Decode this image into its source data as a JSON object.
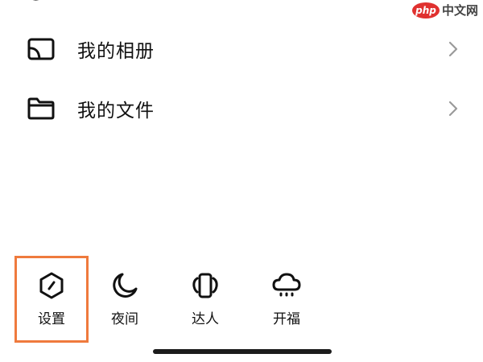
{
  "watermark": {
    "logo": "php",
    "text": "中文网"
  },
  "menu": {
    "items": [
      {
        "label": "我的相册",
        "icon": "album-icon"
      },
      {
        "label": "我的文件",
        "icon": "folder-icon"
      }
    ]
  },
  "quick_actions": {
    "items": [
      {
        "label": "设置",
        "icon": "settings-icon",
        "highlighted": true
      },
      {
        "label": "夜间",
        "icon": "moon-icon",
        "highlighted": false
      },
      {
        "label": "达人",
        "icon": "expert-icon",
        "highlighted": false
      },
      {
        "label": "开福",
        "icon": "cloud-rain-icon",
        "highlighted": false
      }
    ]
  },
  "colors": {
    "highlight_border": "#ef7a3d",
    "watermark_red": "#e0312f",
    "text": "#111111"
  }
}
